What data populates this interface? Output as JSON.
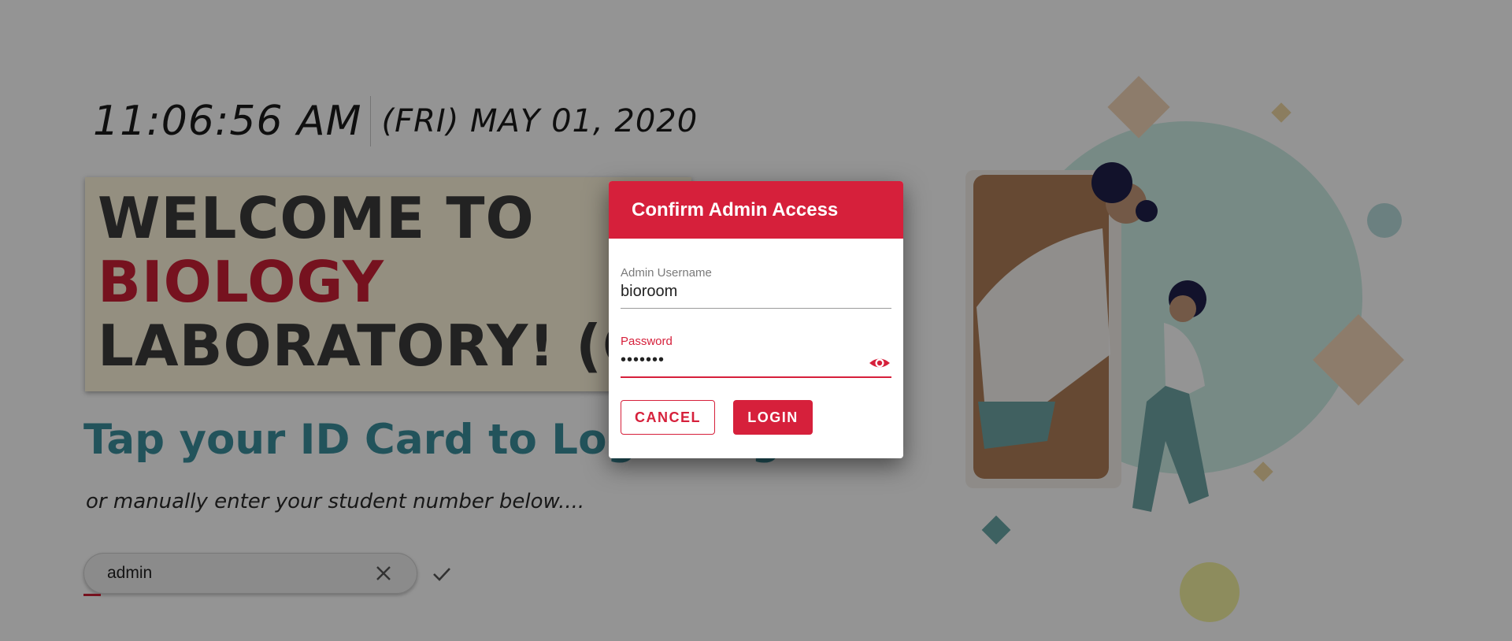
{
  "clock": {
    "time": "11:06:56 AM",
    "date": "(FRI) MAY 01, 2020"
  },
  "welcome": {
    "line1": "WELCOME TO",
    "line2": "BIOLOGY",
    "line3": "LABORATORY! (GI"
  },
  "tap": {
    "title": "Tap your ID Card to Login/Logout",
    "subtitle": "or manually enter your student number below...."
  },
  "student_input": {
    "value": "admin",
    "clear_icon": "close-icon",
    "submit_icon": "check-icon"
  },
  "dialog": {
    "title": "Confirm Admin Access",
    "username_label": "Admin Username",
    "username_value": "bioroom",
    "password_label": "Password",
    "password_value": "•••••••",
    "visibility_icon": "eye-icon",
    "cancel_label": "CANCEL",
    "login_label": "LOGIN"
  },
  "colors": {
    "accent": "#d6203b",
    "teal": "#3c8f9e",
    "overlay": "rgba(0,0,0,0.42)"
  }
}
